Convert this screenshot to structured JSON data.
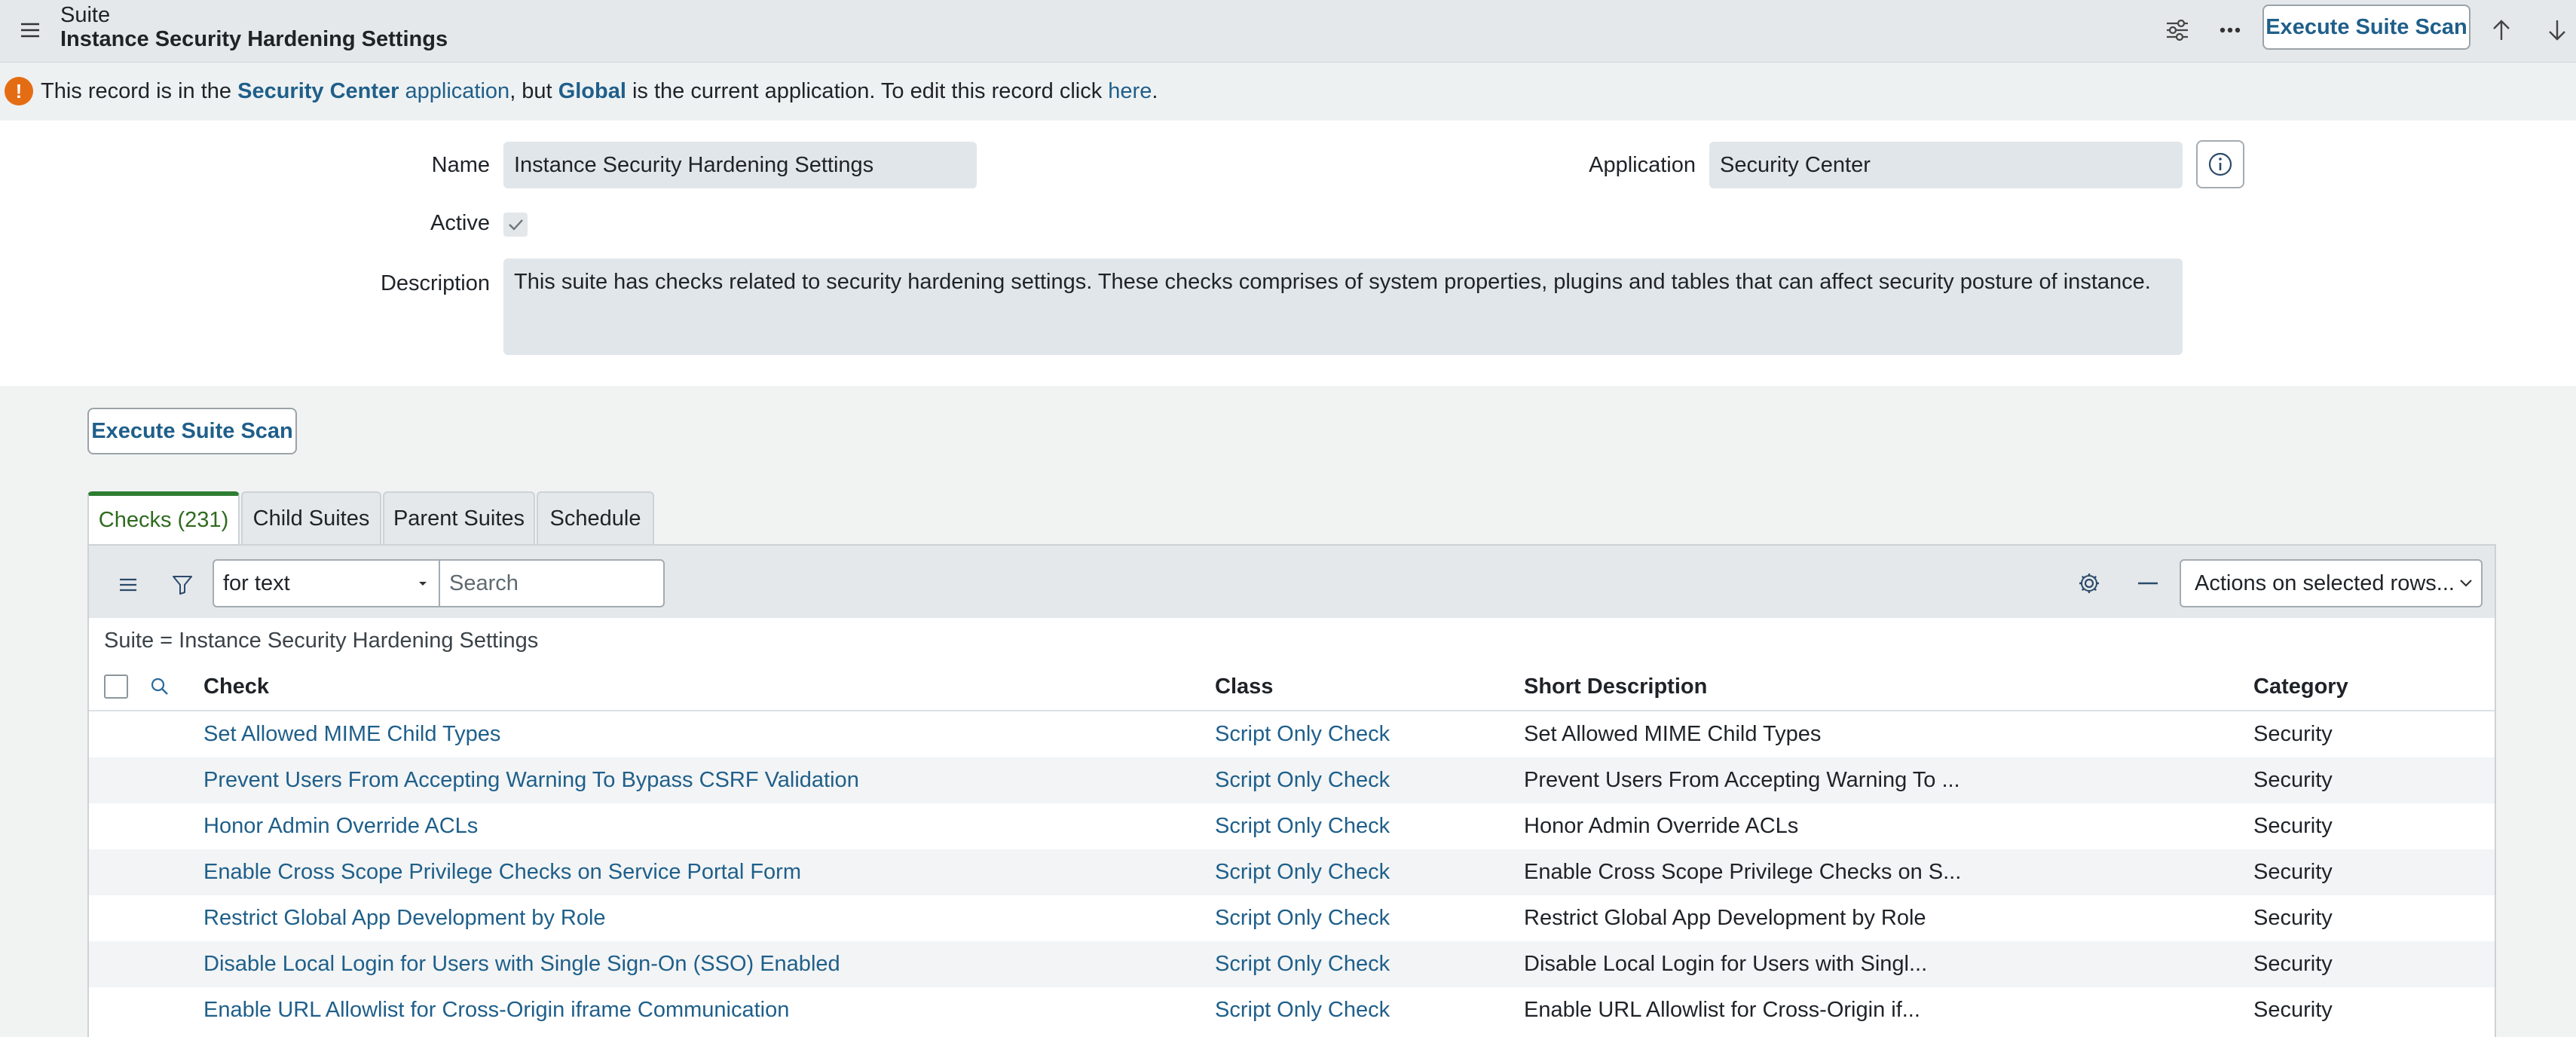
{
  "header": {
    "record_type": "Suite",
    "record_title": "Instance Security Hardening Settings",
    "execute_label": "Execute Suite Scan"
  },
  "banner": {
    "prefix": "This record is in the ",
    "scope": "Security Center",
    "app_word": " application",
    "mid": ", but ",
    "current_app": "Global",
    "suffix": " is the current application. To edit this record click ",
    "here": "here",
    "end": "."
  },
  "form": {
    "name_label": "Name",
    "name_value": "Instance Security Hardening Settings",
    "application_label": "Application",
    "application_value": "Security Center",
    "active_label": "Active",
    "description_label": "Description",
    "description_value": "This suite has checks related to security hardening settings. These checks comprises of system properties, plugins and tables that can affect security posture of instance."
  },
  "related": {
    "execute_label": "Execute Suite Scan",
    "tabs": [
      {
        "label": "Checks (231)"
      },
      {
        "label": "Child Suites"
      },
      {
        "label": "Parent Suites"
      },
      {
        "label": "Schedule"
      }
    ],
    "search_field_select": "for text",
    "search_placeholder": "Search",
    "actions_select": "Actions on selected rows...",
    "filter_breadcrumb": "Suite = Instance Security Hardening Settings",
    "columns": [
      "Check",
      "Class",
      "Short Description",
      "Category"
    ],
    "rows": [
      {
        "check": "Set Allowed MIME Child Types",
        "class": "Script Only Check",
        "short_description": "Set Allowed MIME Child Types",
        "category": "Security"
      },
      {
        "check": "Prevent Users From Accepting Warning To Bypass CSRF Validation",
        "class": "Script Only Check",
        "short_description": "Prevent Users From Accepting Warning To ...",
        "category": "Security"
      },
      {
        "check": "Honor Admin Override ACLs",
        "class": "Script Only Check",
        "short_description": "Honor Admin Override ACLs",
        "category": "Security"
      },
      {
        "check": "Enable Cross Scope Privilege Checks on Service Portal Form",
        "class": "Script Only Check",
        "short_description": "Enable Cross Scope Privilege Checks on S...",
        "category": "Security"
      },
      {
        "check": "Restrict Global App Development by Role",
        "class": "Script Only Check",
        "short_description": "Restrict Global App Development by Role",
        "category": "Security"
      },
      {
        "check": "Disable Local Login for Users with Single Sign-On (SSO) Enabled",
        "class": "Script Only Check",
        "short_description": "Disable Local Login for Users with Singl...",
        "category": "Security"
      },
      {
        "check": "Enable URL Allowlist for Cross-Origin iframe Communication",
        "class": "Script Only Check",
        "short_description": "Enable URL Allowlist for Cross-Origin if...",
        "category": "Security"
      }
    ]
  }
}
